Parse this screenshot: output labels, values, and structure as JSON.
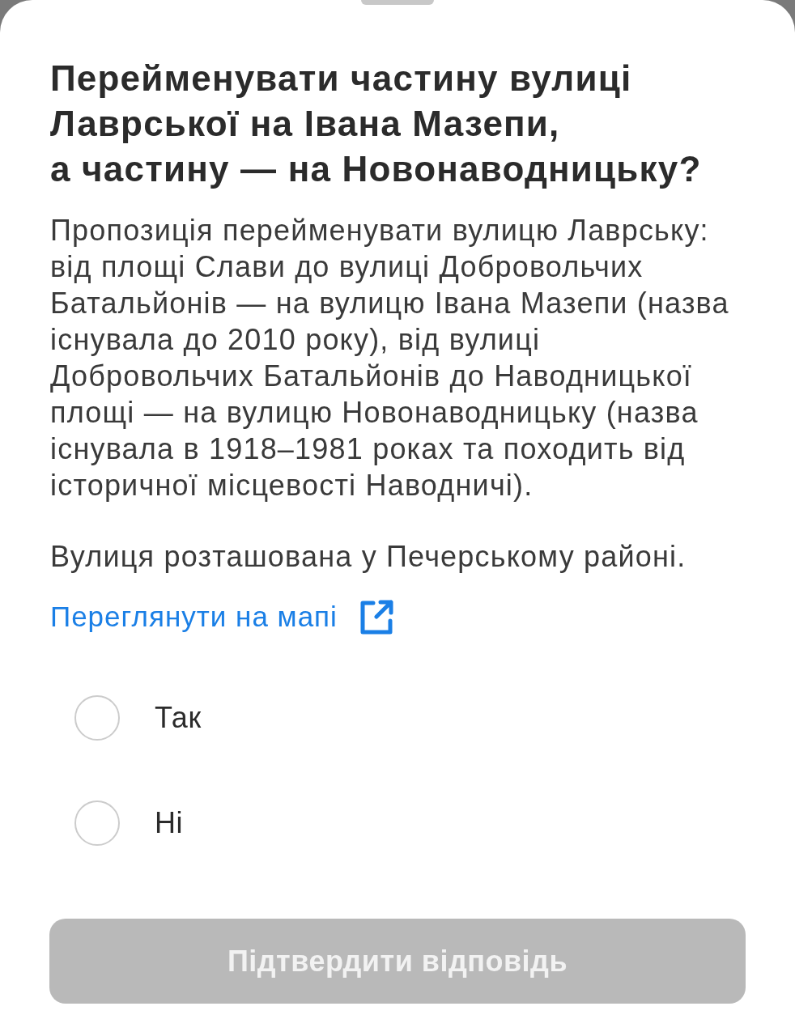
{
  "question": {
    "title": "Перейменувати частину вулиці Лаврської на Івана Мазепи,\nа частину — на Новонаводницьку?",
    "paragraphs": [
      "Пропозиція перейменувати вулицю Лаврську: від площі Слави до вулиці Добровольчих Батальйонів — на вулицю Івана Мазепи (назва існувала до 2010 року), від вулиці Добровольчих Батальйонів до Наводницької площі — на вулицю Новонаводницьку (назва існувала в 1918–1981 роках та походить від історичної місцевості Наводничі).",
      "Вулиця розташована у Печерському районі."
    ],
    "map_link": "Переглянути на мапі"
  },
  "options": [
    {
      "label": "Так",
      "selected": false
    },
    {
      "label": "Ні",
      "selected": false
    }
  ],
  "submit_button": {
    "label": "Підтвердити відповідь",
    "disabled": true
  }
}
